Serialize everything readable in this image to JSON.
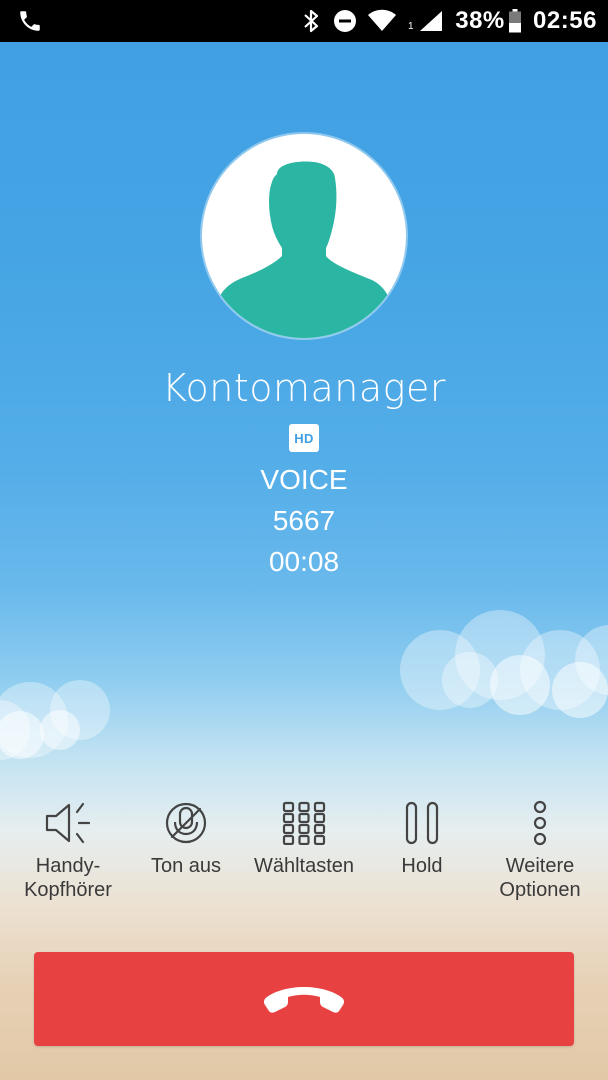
{
  "status_bar": {
    "left_icon": "phone-call-icon",
    "icons": [
      "bluetooth-icon",
      "do-not-disturb-icon",
      "wifi-icon",
      "cell-signal-icon",
      "battery-icon"
    ],
    "sim_slot": "1",
    "battery": "38%",
    "time": "02:56"
  },
  "call": {
    "avatar_icon": "person-silhouette-icon",
    "avatar_color": "#2bb6a3",
    "caller_name": "Kontomanager",
    "hd_badge": "HD",
    "call_type": "VOICE",
    "number": "5667",
    "duration": "00:08"
  },
  "actions": [
    {
      "icon": "speaker-icon",
      "label": "Handy-\nKopfhörer"
    },
    {
      "icon": "mute-icon",
      "label": "Ton aus"
    },
    {
      "icon": "dialpad-icon",
      "label": "Wähltasten"
    },
    {
      "icon": "pause-icon",
      "label": "Hold"
    },
    {
      "icon": "more-options-icon",
      "label": "Weitere\nOptionen"
    }
  ],
  "end_call": {
    "icon": "end-call-icon",
    "color": "#e84142"
  }
}
